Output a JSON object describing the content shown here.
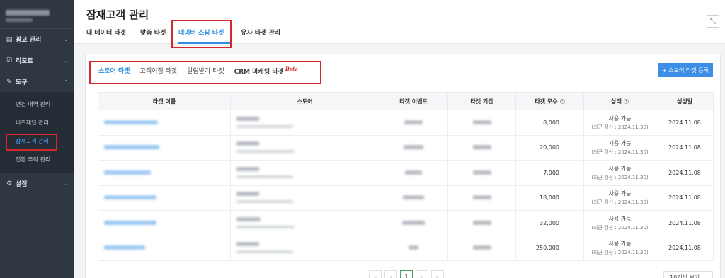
{
  "sidebar": {
    "items": [
      {
        "label": "광고 관리",
        "icon": "ad-icon"
      },
      {
        "label": "리포트",
        "icon": "report-icon"
      },
      {
        "label": "도구",
        "icon": "pencil-icon"
      },
      {
        "label": "설정",
        "icon": "gear-icon"
      }
    ],
    "subitems": [
      {
        "label": "변경 내역 관리"
      },
      {
        "label": "비즈채널 관리"
      },
      {
        "label": "잠재고객 관리"
      },
      {
        "label": "전환 추적 관리"
      }
    ]
  },
  "header": {
    "title": "잠재고객 관리",
    "tabs": [
      "내 데이터 타겟",
      "맞춤 타겟",
      "네이버 쇼핑 타겟",
      "유사 타겟 관리"
    ]
  },
  "content": {
    "sub_tabs": [
      "스토어 타겟",
      "고객여정 타겟",
      "알림받기 타겟",
      "CRM 마케팅 타겟"
    ],
    "beta_label": "Beta",
    "add_button": "+ 스토어 타겟 등록",
    "table": {
      "headers": [
        "타겟 이름",
        "스토어",
        "타겟 이벤트",
        "타겟 기간",
        "타겟 모수",
        "상태",
        "생성일"
      ],
      "rows": [
        {
          "size": "8,000",
          "status": "사용 가능",
          "updated": "(최근 갱신 : 2024.11.30)",
          "created": "2024.11.08"
        },
        {
          "size": "20,000",
          "status": "사용 가능",
          "updated": "(최근 갱신 : 2024.11.30)",
          "created": "2024.11.08"
        },
        {
          "size": "7,000",
          "status": "사용 가능",
          "updated": "(최근 갱신 : 2024.11.30)",
          "created": "2024.11.08"
        },
        {
          "size": "18,000",
          "status": "사용 가능",
          "updated": "(최근 갱신 : 2024.11.30)",
          "created": "2024.11.08"
        },
        {
          "size": "32,000",
          "status": "사용 가능",
          "updated": "(최근 갱신 : 2024.11.30)",
          "created": "2024.11.08"
        },
        {
          "size": "250,000",
          "status": "사용 가능",
          "updated": "(최근 갱신 : 2024.11.30)",
          "created": "2024.11.08"
        }
      ]
    },
    "pagination": {
      "current": "1"
    },
    "page_size": "10개씩 보기"
  },
  "colors": {
    "accent": "#2f8fe0",
    "highlight": "#d6282b",
    "sidebar_bg": "#2f3742"
  }
}
